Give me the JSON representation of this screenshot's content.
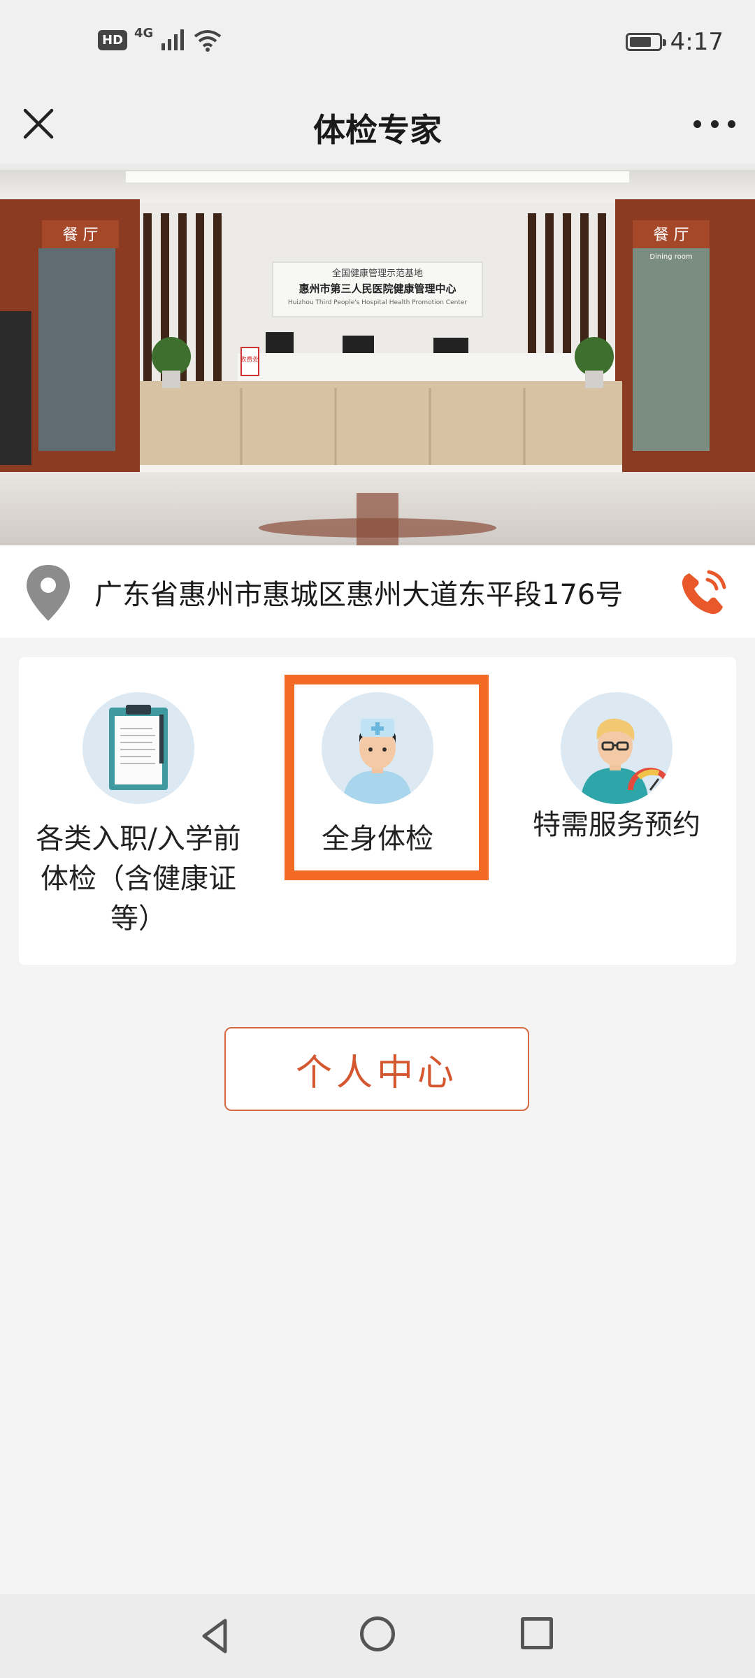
{
  "status_bar": {
    "hd_label": "HD",
    "network_label": "4G",
    "time": "4:17",
    "battery_level": 0.75
  },
  "nav": {
    "title": "体检专家"
  },
  "hero": {
    "dining_sign_left": "餐 厅",
    "dining_sign_right": "餐 厅",
    "dining_sub": "Dining room",
    "wall_sign_line1": "全国健康管理示范基地",
    "wall_sign_line2": "惠州市第三人民医院健康管理中心",
    "wall_sign_line3": "Huizhou Third People's Hospital Health Promotion Center",
    "counter_sign": "收费处"
  },
  "address": {
    "text": "广东省惠州市惠城区惠州大道东平段176号"
  },
  "services": [
    {
      "label": "各类入职/入学前体检（含健康证等）",
      "icon": "clipboard-icon"
    },
    {
      "label": "全身体检",
      "icon": "nurse-avatar-icon"
    },
    {
      "label": "特需服务预约",
      "icon": "doctor-avatar-icon"
    }
  ],
  "personal_center": {
    "label": "个人中心"
  },
  "colors": {
    "accent": "#f26a24",
    "button_text": "#d4572f",
    "phone_icon": "#e8582a"
  }
}
